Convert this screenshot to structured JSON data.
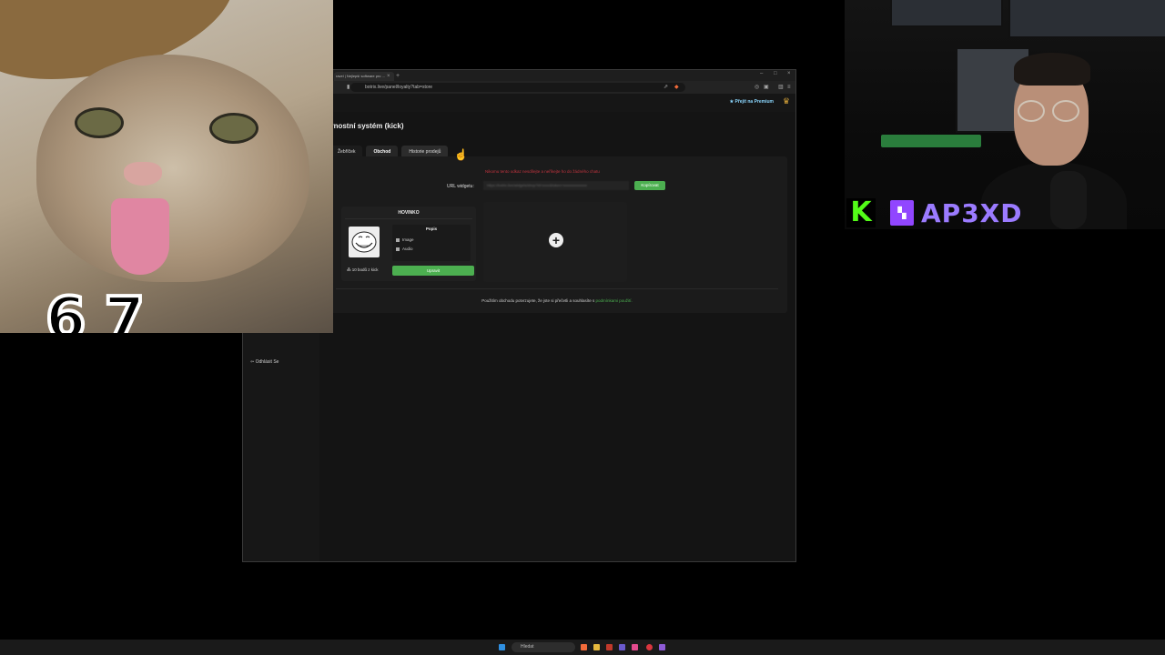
{
  "browser": {
    "tab_title": "ravel | Nejlepší software pro ...",
    "tab_close": "×",
    "tab_new": "+",
    "url": "botrix.live/panel/loyalty?tab=store",
    "premium_label": "Přejít na Premium",
    "logout_label": "Odhlásit Se"
  },
  "page": {
    "title": "ěrnostní systém (kick)",
    "tabs": [
      {
        "label": "Žebříček"
      },
      {
        "label": "Obchod"
      },
      {
        "label": "Historie prodejů"
      }
    ],
    "warning": "Nikomu tento odkaz nesdílejte a neříkejte ho do žádného chatu",
    "url_label": "URL widgetu:",
    "widget_url": "https://botrix.live/widgets/shop?id=xxxx&token=xxxxxxxxxxxxx",
    "copy_label": "Kopírovat",
    "card": {
      "title": "HOVINKO",
      "inner_title": "Popis",
      "items": [
        "Image",
        "Audio"
      ],
      "price": "10 bodů z kick",
      "edit_label": "Upravit"
    },
    "add_icon": "+",
    "terms_text": "Použitím obchodu potvrzujete, že jste si přečetli a souhlasíte s ",
    "terms_link": "podmínkami použití."
  },
  "overlay": {
    "sticker_text": "67"
  },
  "webcam": {
    "channel_name": "AP3XD",
    "kick_letter": "K"
  },
  "taskbar": {
    "search_placeholder": "Hledat"
  }
}
